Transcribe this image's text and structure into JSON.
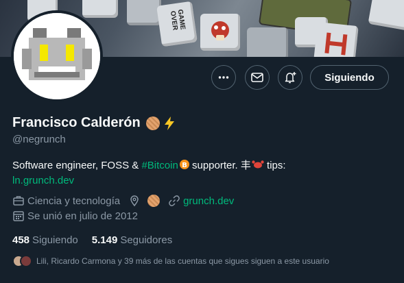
{
  "profile": {
    "name": "Francisco Calderón",
    "handle": "@negrunch",
    "bio": {
      "part1": "Software engineer, FOSS & ",
      "hashtag": "#Bitcoin",
      "part2": " supporter. 丰",
      "part3": " tips:",
      "link": "ln.grunch.dev"
    },
    "category": "Ciencia y tecnología",
    "website": "grunch.dev",
    "joined": "Se unió en julio de 2012"
  },
  "banner": {
    "key_label_1": "GAME",
    "key_label_2": "OVER"
  },
  "actions": {
    "more_label": "Más",
    "message_label": "Mensaje",
    "notify_label": "Notificaciones",
    "follow_label": "Siguiendo"
  },
  "stats": {
    "following_count": "458",
    "following_label": "Siguiendo",
    "followers_count": "5.149",
    "followers_label": "Seguidores"
  },
  "followers_you_know": "Lili, Ricardo Carmona y 39 más de las cuentas que sigues siguen a este usuario",
  "colors": {
    "background": "#15202b",
    "accent": "#1d9bf0",
    "link_green": "#00ba7c",
    "secondary_text": "#8b98a5",
    "border": "#536471"
  }
}
